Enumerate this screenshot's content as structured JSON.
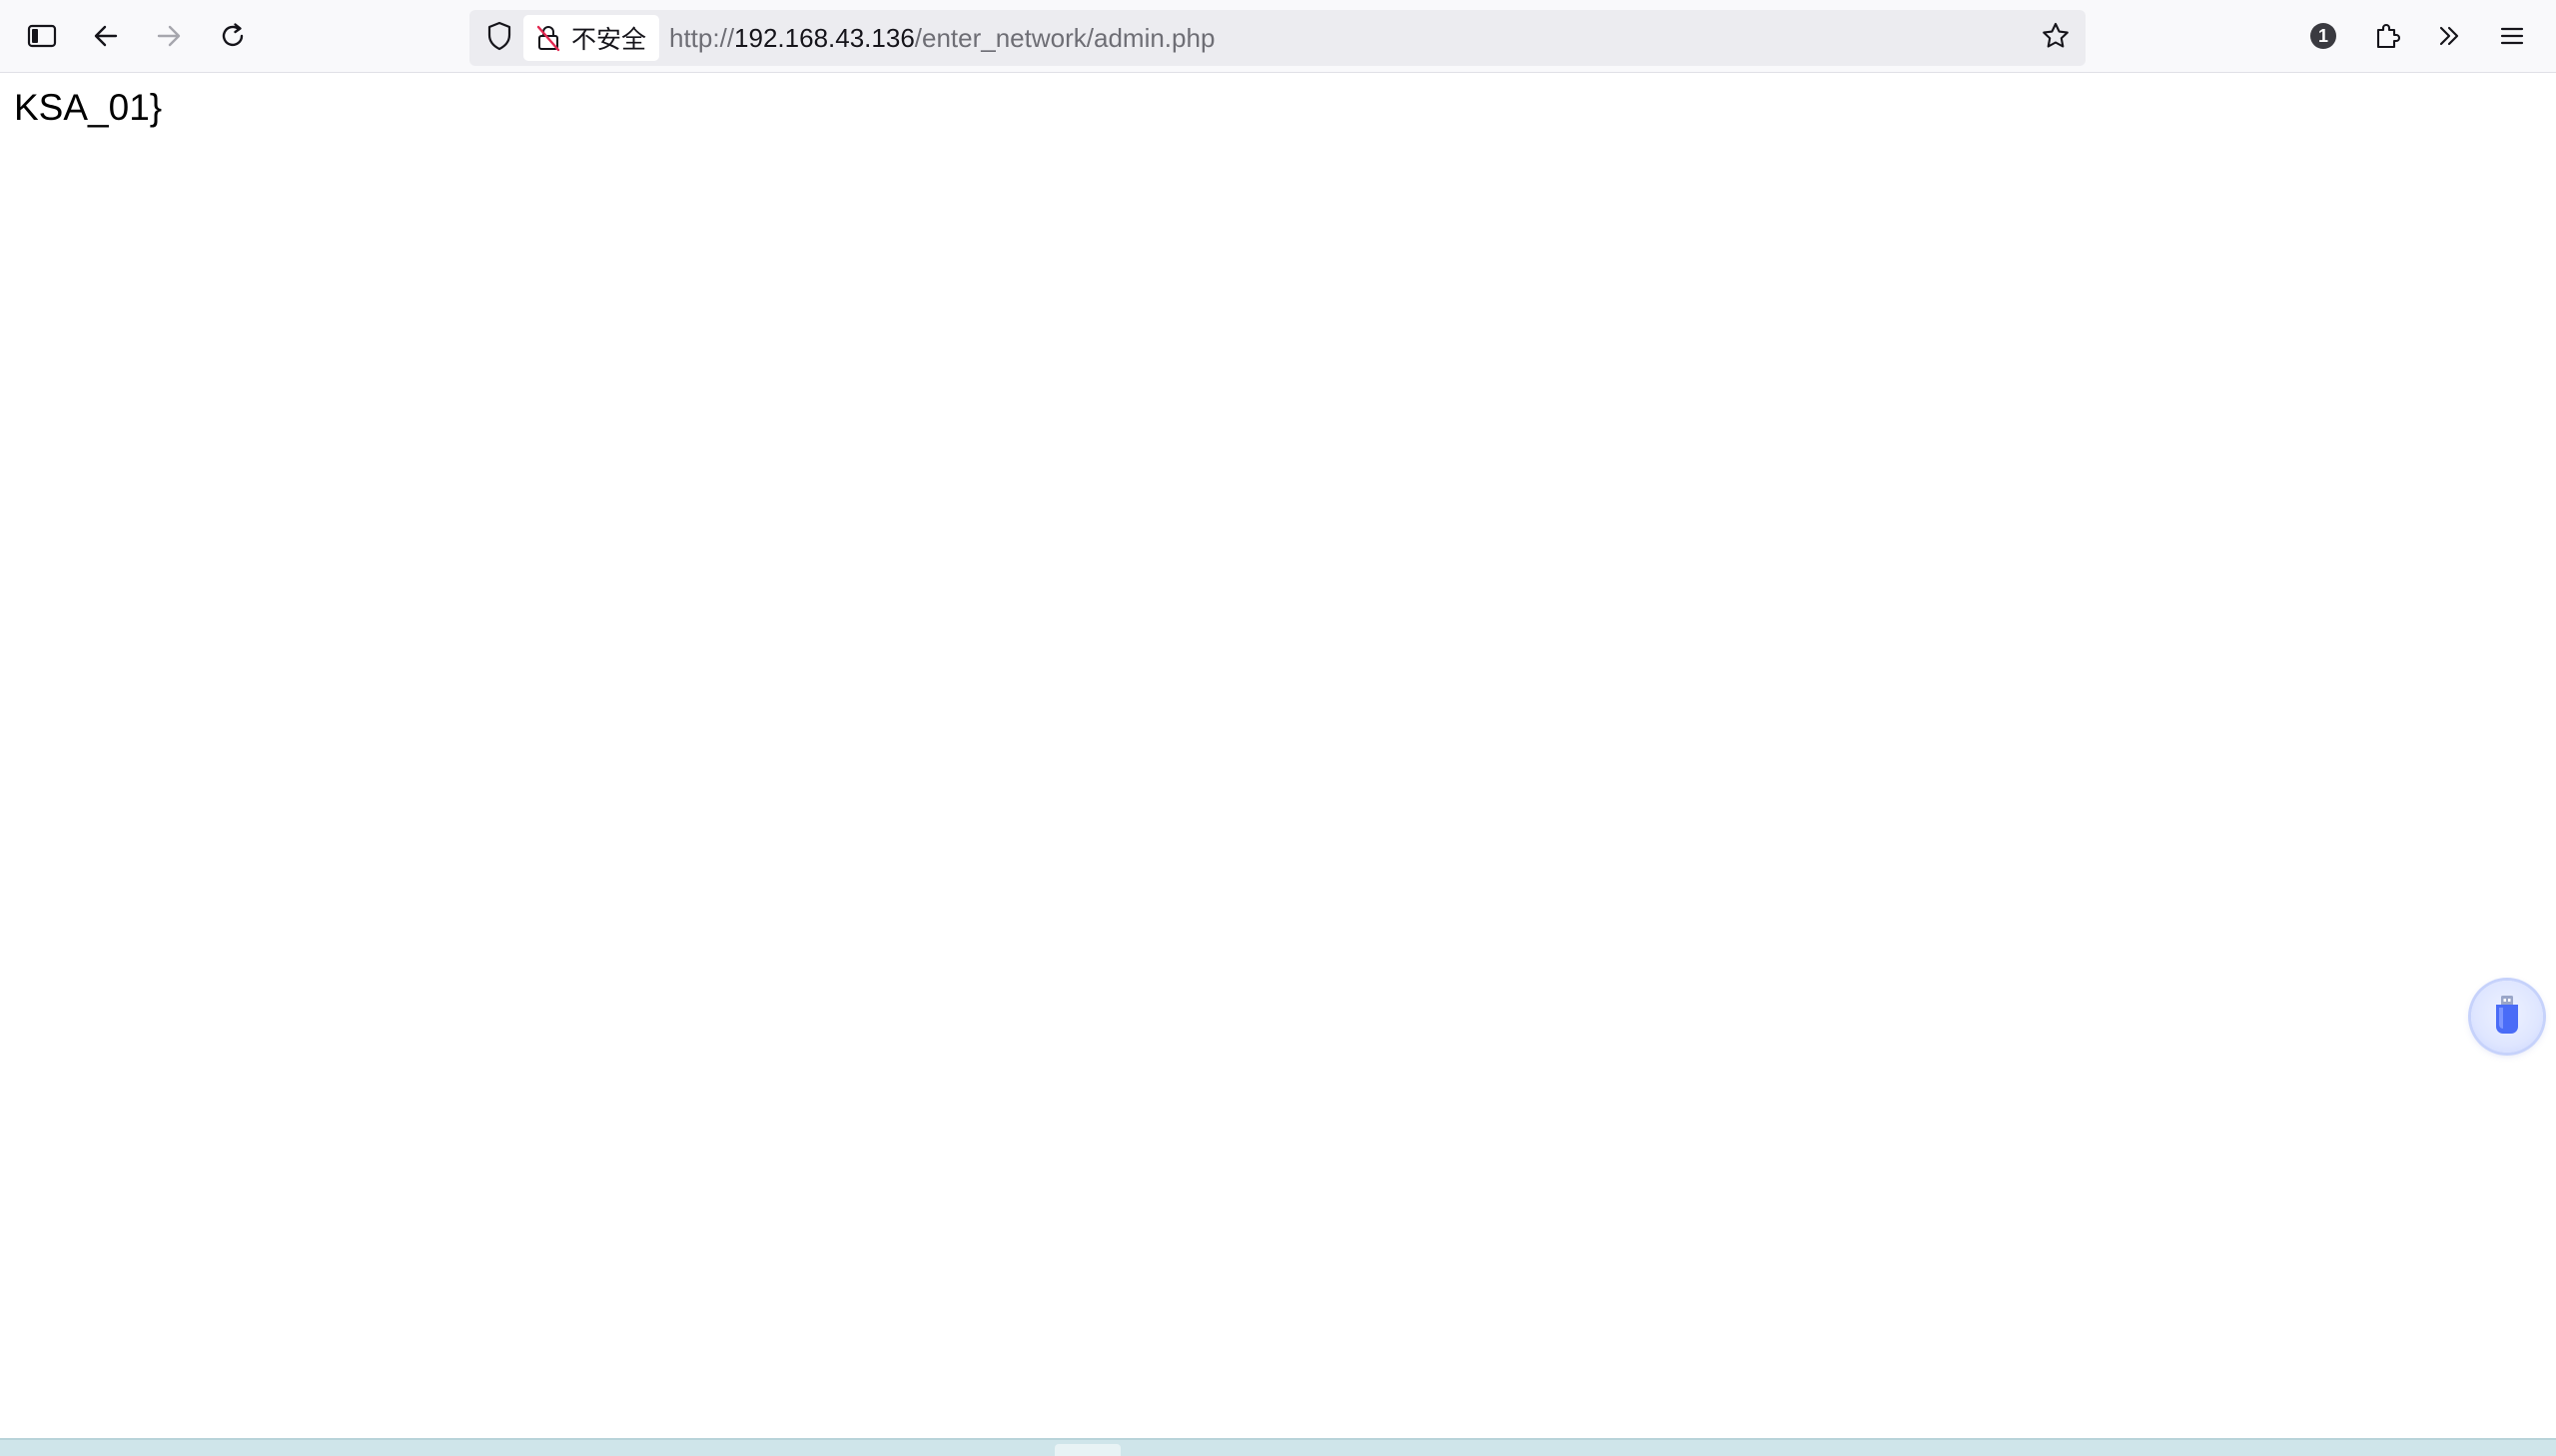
{
  "browser": {
    "url_scheme": "http://",
    "url_host": "192.168.43.136",
    "url_path": "/enter_network/admin.php",
    "insecure_label": "不安全",
    "notification_count": "1",
    "icons": {
      "sidebar": "sidebar-icon",
      "back": "arrow-left-icon",
      "forward": "arrow-right-icon",
      "reload": "reload-icon",
      "shield": "shield-icon",
      "insecure_lock": "crossed-lock-icon",
      "bookmark": "star-icon",
      "account": "badge-icon",
      "extensions": "puzzle-icon",
      "overflow": "double-chevron-icon",
      "menu": "hamburger-icon"
    }
  },
  "page": {
    "body_text": "KSA_01}"
  },
  "floating_widget": {
    "icon": "usb-drive-icon",
    "accent": "#4a6cf7"
  }
}
